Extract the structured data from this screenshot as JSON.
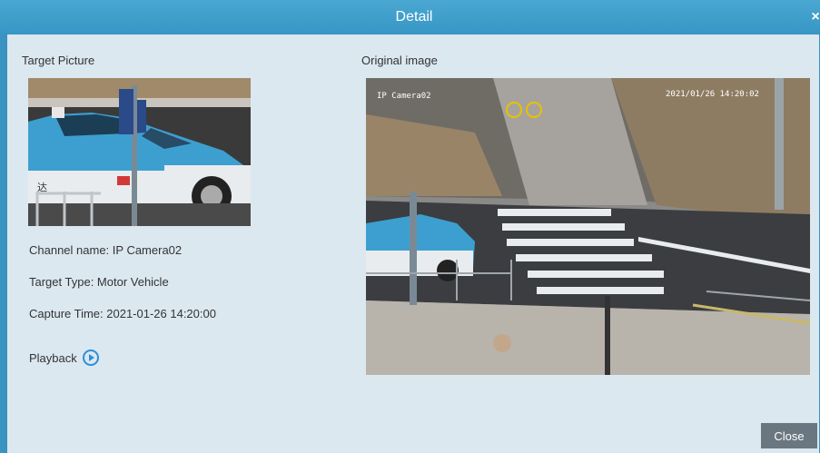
{
  "dialog": {
    "title": "Detail",
    "close_icon": "×"
  },
  "target_picture": {
    "label": "Target Picture",
    "channel_name": "Channel name: IP Camera02",
    "target_type": "Target Type: Motor Vehicle",
    "capture_time": "Capture Time: 2021-01-26 14:20:00",
    "playback_label": "Playback",
    "taxi_text": "达"
  },
  "original_image": {
    "label": "Original image",
    "camera_overlay": "IP Camera02",
    "timestamp_overlay": "2021/01/26 14:20:02"
  },
  "footer": {
    "close_label": "Close"
  },
  "colors": {
    "titlebar": "#3a93c0",
    "dialog_bg": "#dbe8f0",
    "close_button": "#6b7780",
    "play_icon": "#2f8fd8"
  }
}
